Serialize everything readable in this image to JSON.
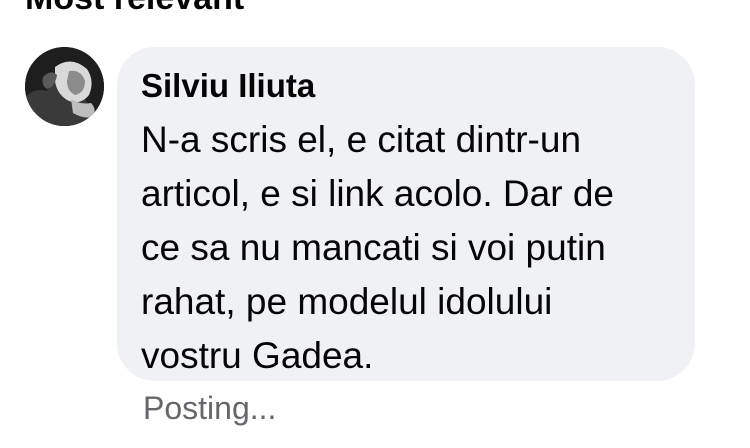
{
  "section": {
    "title": "Most relevant"
  },
  "comment": {
    "author": "Silviu Iliuta",
    "avatar_icon": "user-avatar-photo",
    "lines": [
      "N-a scris el, e citat dintr-un",
      "articol, e si link acolo. Dar de",
      "ce sa nu mancati si voi putin",
      "rahat, pe modelul idolului",
      "vostru Gadea."
    ],
    "status": "Posting..."
  },
  "colors": {
    "bubble_background": "#f0f1f4",
    "text_primary": "#050505",
    "text_secondary": "#65676b"
  }
}
